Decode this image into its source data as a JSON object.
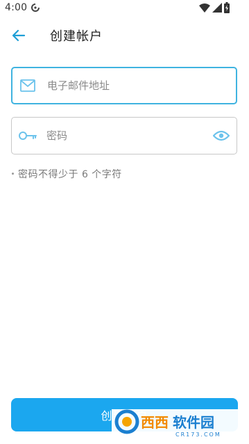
{
  "status_bar": {
    "time": "4:00"
  },
  "app_bar": {
    "title": "创建帐户",
    "back_icon": "arrow-left-icon"
  },
  "form": {
    "email": {
      "placeholder": "电子邮件地址",
      "value": "",
      "icon": "mail-icon"
    },
    "password": {
      "placeholder": "密码",
      "value": "",
      "icon": "key-icon",
      "toggle_icon": "eye-icon"
    },
    "hint": "密码不得少于 6 个字符"
  },
  "actions": {
    "create_account_label": "创建帐户"
  },
  "watermark": {
    "brand": "西西软件园",
    "url": "CR173.COM"
  },
  "colors": {
    "accent": "#1ba7ef",
    "focus_border": "#3fb3e0",
    "icon": "#6cc3ec"
  }
}
